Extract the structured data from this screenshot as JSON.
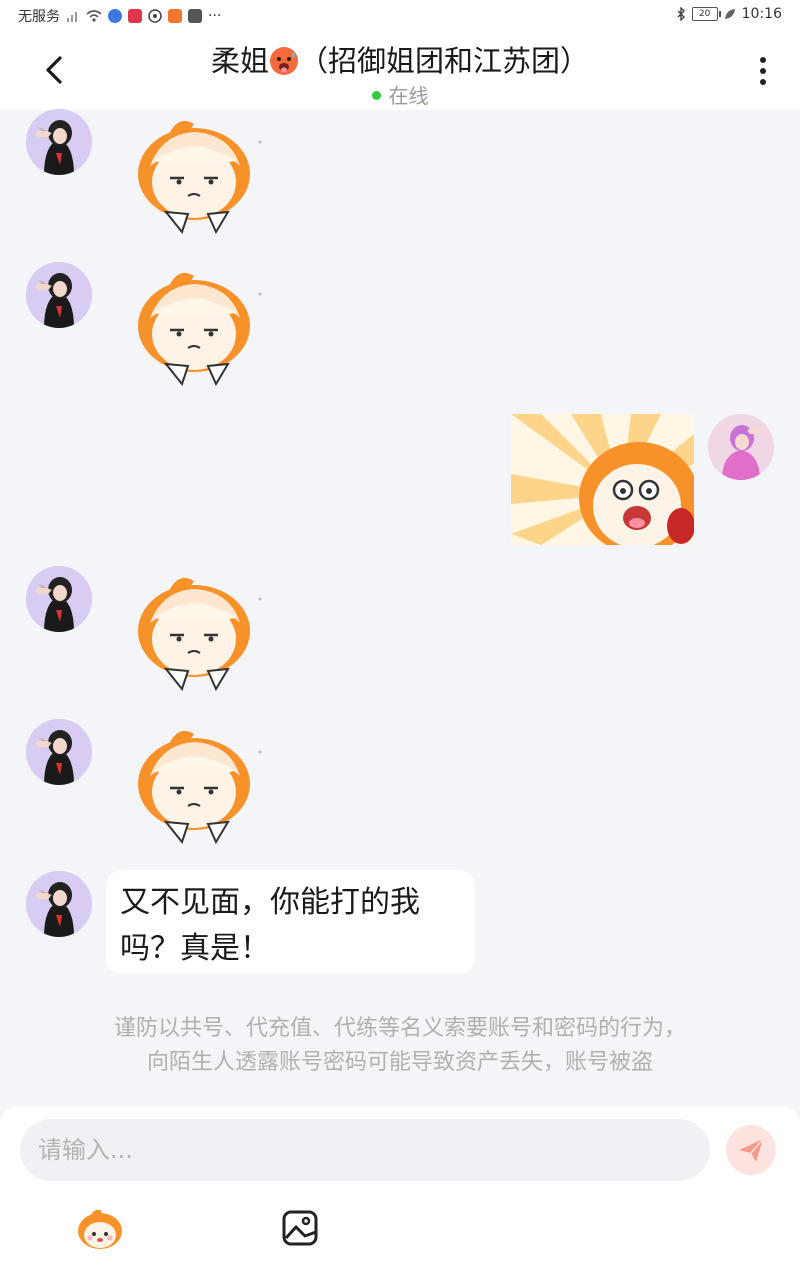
{
  "status_bar": {
    "carrier": "无服务",
    "more": "···",
    "battery": "20",
    "time": "10:16"
  },
  "header": {
    "title_name": "柔姐",
    "title_suffix": "（招御姐团和江苏团）",
    "status": "在线"
  },
  "messages": [
    {
      "side": "left",
      "kind": "sticker",
      "icon": "bored-mascot-sticker"
    },
    {
      "side": "left",
      "kind": "sticker",
      "icon": "bored-mascot-sticker"
    },
    {
      "side": "right",
      "kind": "sticker",
      "icon": "shouting-mascot-sticker"
    },
    {
      "side": "left",
      "kind": "sticker",
      "icon": "bored-mascot-sticker"
    },
    {
      "side": "left",
      "kind": "sticker",
      "icon": "bored-mascot-sticker"
    },
    {
      "side": "left",
      "kind": "text",
      "lines": [
        "又不见面，你能打的我",
        "吗？真是！"
      ]
    }
  ],
  "notice": {
    "line1": "谨防以共号、代充值、代练等名义索要账号和密码的行为，",
    "line2": "向陌生人透露账号密码可能导致资产丢失，账号被盗"
  },
  "composer": {
    "placeholder": "请输入..."
  },
  "colors": {
    "online": "#2ecc40",
    "mascot_orange": "#f7922a",
    "send_button_bg": "#fde4e0",
    "send_icon": "#f59a8a"
  }
}
